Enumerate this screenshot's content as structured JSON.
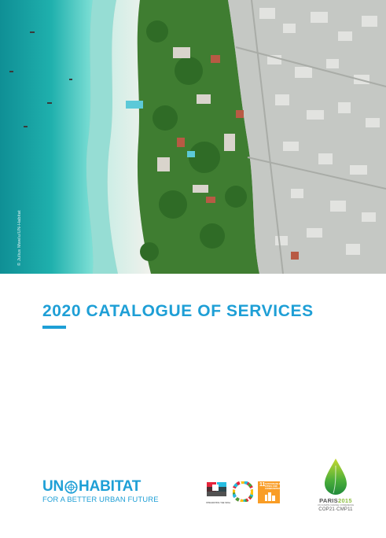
{
  "photo": {
    "credit": "© Julius Mwelu/UN-Habitat",
    "colors": {
      "ocean_deep": "#169a9a",
      "ocean_shallow": "#5fd3cf",
      "sand": "#e8ece6",
      "vegetation": "#3d7a2f",
      "rooftops": "#c9ccc8"
    }
  },
  "title": {
    "text": "2020 CATALOGUE OF SERVICES",
    "color": "#1e9fd6"
  },
  "footer": {
    "unhabitat": {
      "name_left": "UN",
      "name_right": "HABITAT",
      "tagline": "FOR A BETTER URBAN FUTURE",
      "emblem_icon": "un-emblem-icon"
    },
    "sdg": {
      "integrating_label": "INTEGRATING THE SDGs",
      "wheel_icon": "sdg-wheel-icon",
      "goal_number": "11",
      "goal_label": "SUSTAINABLE CITIES AND COMMUNITIES"
    },
    "paris": {
      "name": "PARIS",
      "year": "2015",
      "subtitle": "UN CLIMATE CHANGE CONFERENCE",
      "cop": "COP21·CMP11"
    }
  }
}
